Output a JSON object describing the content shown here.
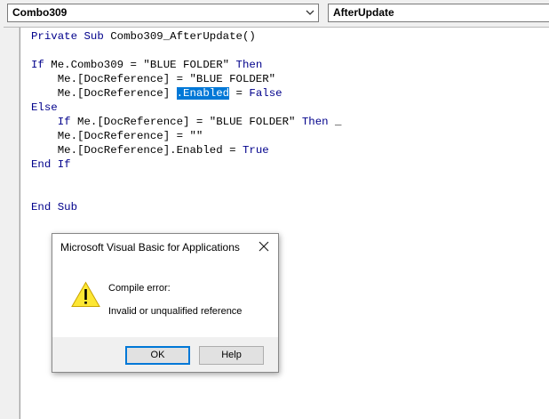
{
  "toolbar": {
    "object_combo_value": "Combo309",
    "procedure_combo_value": "AfterUpdate"
  },
  "code": {
    "l1_kw1": "Private",
    "l1_kw2": "Sub",
    "l1_rest": " Combo309_AfterUpdate()",
    "l3_kw": "If",
    "l3_mid": " Me.Combo309 = \"BLUE FOLDER\" ",
    "l3_kw2": "Then",
    "l4": "    Me.[DocReference] = \"BLUE FOLDER\"",
    "l5_pre": "    Me.[DocReference] ",
    "l5_sel": ".Enabled",
    "l5_mid": " = ",
    "l5_kw": "False",
    "l6_kw": "Else",
    "l7_pre": "    ",
    "l7_kw": "If",
    "l7_mid": " Me.[DocReference] = \"BLUE FOLDER\" ",
    "l7_kw2": "Then",
    "l7_end": " _",
    "l8": "    Me.[DocReference] = \"\"",
    "l9_pre": "    Me.[DocReference].Enabled = ",
    "l9_kw": "True",
    "l10_kw1": "End",
    "l10_kw2": "If",
    "l13_kw1": "End",
    "l13_kw2": "Sub"
  },
  "dialog": {
    "title": "Microsoft Visual Basic for Applications",
    "message_title": "Compile error:",
    "message_body": "Invalid or unqualified reference",
    "ok_label": "OK",
    "help_label": "Help",
    "icon": "warning-icon",
    "close_icon": "close-icon"
  },
  "colors": {
    "keyword": "#00008b",
    "selection": "#0078d7",
    "default_button_border": "#0078d7"
  }
}
